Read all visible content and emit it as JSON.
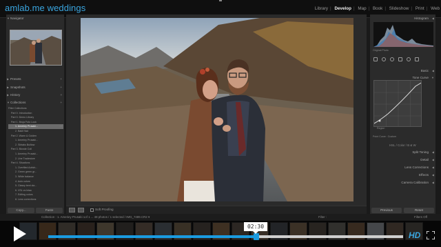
{
  "app": {
    "brand": "amlab.me weddings",
    "modules": [
      "Library",
      "Develop",
      "Map",
      "Book",
      "Slideshow",
      "Print",
      "Web"
    ],
    "active_module": "Develop"
  },
  "left_panel": {
    "navigator_label": "Navigator",
    "sections": [
      "Presets",
      "Snapshots",
      "History",
      "Collections"
    ],
    "collections": [
      {
        "label": "Filter Collections",
        "count": ""
      },
      {
        "label": "Part 0. Introduction",
        "count": ""
      },
      {
        "label": "Part 0. Demo Library",
        "count": ""
      },
      {
        "label": "Part 1. Bruja Foto Look",
        "count": ""
      },
      {
        "label": "1. Ameriey Prusaki...",
        "count": "48",
        "selected": true
      },
      {
        "label": "2. Bakit 9ad",
        "count": ""
      },
      {
        "label": "Part 2. Warm & Golden",
        "count": ""
      },
      {
        "label": "1. Ameriey Prusaki...",
        "count": ""
      },
      {
        "label": "2. Sibtaks Builtow",
        "count": ""
      },
      {
        "label": "Part 3. Blonde Coll",
        "count": ""
      },
      {
        "label": "1. Ameriey Prusaki...",
        "count": ""
      },
      {
        "label": "2. Une Tradestore",
        "count": ""
      },
      {
        "label": "Part 4. Situations",
        "count": ""
      },
      {
        "label": "1. Overfiled Adrich...",
        "count": ""
      },
      {
        "label": "2. Green green gr...",
        "count": ""
      },
      {
        "label": "3. White balance",
        "count": ""
      },
      {
        "label": "4. Auto colors",
        "count": ""
      },
      {
        "label": "5. Classy beni cla...",
        "count": ""
      },
      {
        "label": "6. VSL vs Intac",
        "count": ""
      },
      {
        "label": "7. Editing colors",
        "count": ""
      },
      {
        "label": "8. Lens corrections",
        "count": ""
      }
    ],
    "copy_button": "Copy...",
    "paste_button": "Paste"
  },
  "toolbar": {
    "softproof_label": "Soft Proofing"
  },
  "right_panel": {
    "histogram_label": "Histogram",
    "histogram_info": "Original Photo",
    "basic_label": "Basic",
    "tone_curve_label": "Tone Curve",
    "curve_region_label": "Region",
    "point_curve_label": "Point Curve : Custom",
    "hsl_row": "HSL / Color / B & W",
    "split_toning_label": "Split Toning",
    "detail_label": "Detail",
    "lens_corrections_label": "Lens Corrections",
    "effects_label": "Effects",
    "camera_calibration_label": "Camera Calibration",
    "previous_button": "Previous",
    "reset_button": "Reset"
  },
  "filmstrip_bar": {
    "path": "Collection : 1. Ameriey Prusaki 1of 1 ... 48 photos / 1 selected / IMG_7489.CR2 ▾",
    "filter_label": "Filter :",
    "filter_value": "Filters Off"
  },
  "player": {
    "time": "02:30",
    "progress": 0.58,
    "hd_label": "HD"
  },
  "colors": {
    "accent": "#1a9be0",
    "brand": "#3aa6e0"
  }
}
